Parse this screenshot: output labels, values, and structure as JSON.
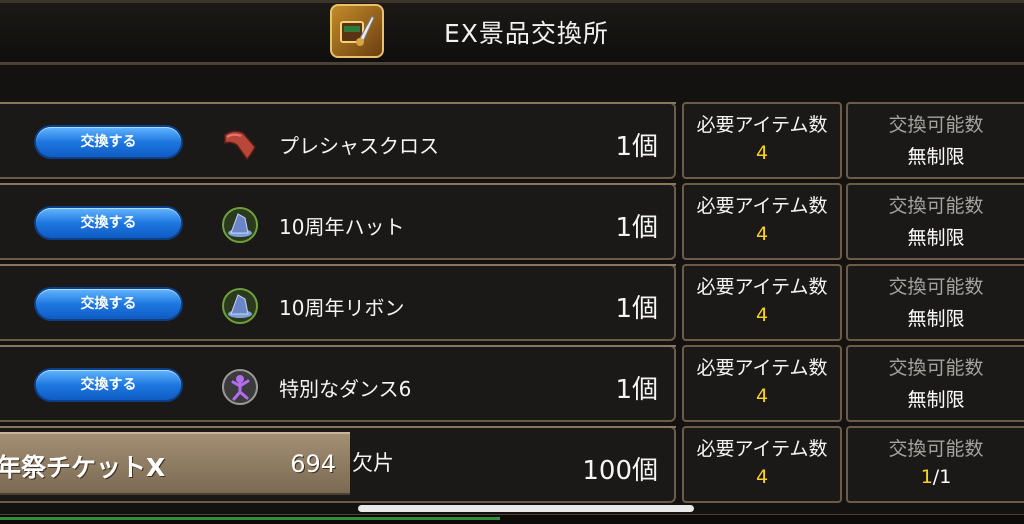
{
  "header": {
    "title": "EX景品交換所",
    "icon": "shop-treasure-icon"
  },
  "rows": [
    {
      "button": "交換する",
      "icon": "cloth-icon",
      "name": "プレシャスクロス",
      "qty": "1個",
      "req_label": "必要アイテム数",
      "req_value": "4",
      "lim_label": "交換可能数",
      "lim_value": "無制限"
    },
    {
      "button": "交換する",
      "icon": "hat-icon",
      "name": "10周年ハット",
      "qty": "1個",
      "req_label": "必要アイテム数",
      "req_value": "4",
      "lim_label": "交換可能数",
      "lim_value": "無制限"
    },
    {
      "button": "交換する",
      "icon": "hat-icon",
      "name": "10周年リボン",
      "qty": "1個",
      "req_label": "必要アイテム数",
      "req_value": "4",
      "lim_label": "交換可能数",
      "lim_value": "無制限"
    },
    {
      "button": "交換する",
      "icon": "dance-icon",
      "name": "特別なダンス6",
      "qty": "1個",
      "req_label": "必要アイテム数",
      "req_value": "4",
      "lim_label": "交換可能数",
      "lim_value": "無制限"
    },
    {
      "qty": "100個",
      "req_label": "必要アイテム数",
      "req_value": "4",
      "lim_label": "交換可能数",
      "lim_value_current": "1",
      "lim_value_total": "/1"
    }
  ],
  "ticket": {
    "name": "年祭チケットX",
    "count": "694",
    "fragment_label": "欠片"
  },
  "colors": {
    "accent_yellow": "#ffd21a",
    "button_blue": "#1e77e0"
  }
}
